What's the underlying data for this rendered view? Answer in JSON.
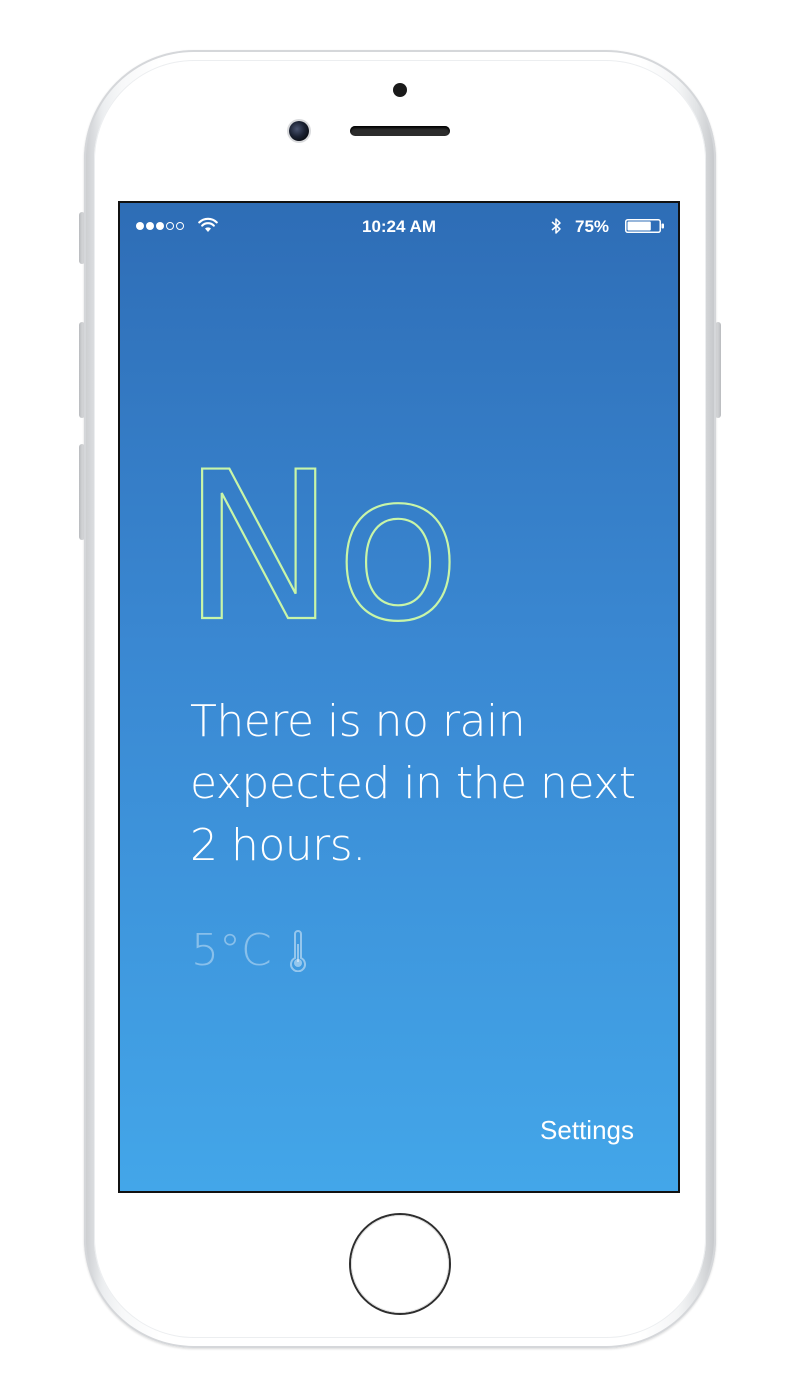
{
  "status_bar": {
    "time": "10:24 AM",
    "battery_percent": "75%",
    "battery_level": 0.75,
    "signal_strength": 3,
    "signal_total": 5,
    "icons": [
      "wifi-icon",
      "bluetooth-icon",
      "battery-icon"
    ]
  },
  "main": {
    "answer": "No",
    "answer_color": "#c8f5a8",
    "message": "There is no rain expected in the next 2 hours.",
    "temperature": "5°C",
    "temperature_icon": "thermometer-icon"
  },
  "footer": {
    "settings_label": "Settings"
  },
  "colors": {
    "screen_top": "#2e6db6",
    "screen_bottom": "#43a6e9",
    "text": "#ffffff"
  }
}
